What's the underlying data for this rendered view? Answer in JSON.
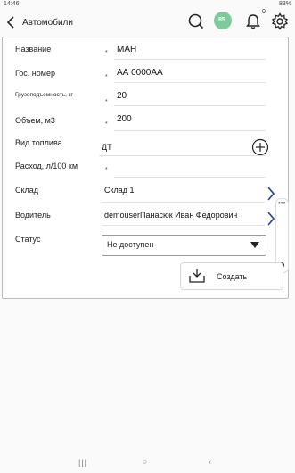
{
  "status_bar": {
    "time": "14:46",
    "battery": "83%"
  },
  "header": {
    "title": "Автомобили",
    "badge_label": "85",
    "notifications_count": "0"
  },
  "form": {
    "name_label": "Название",
    "name_value": "МАН",
    "plate_label": "Гос. номер",
    "plate_value": "АА 0000АА",
    "capacity_label": "Грузоподъемность, кг",
    "capacity_value": "20",
    "volume_label": "Объем, м3",
    "volume_value": "200",
    "fuel_label": "Вид топлива",
    "fuel_value": "ДТ",
    "consumption_label": "Расход, л/100 км",
    "consumption_value": "",
    "warehouse_label": "Склад",
    "warehouse_value": "Склад 1",
    "driver_label": "Водитель",
    "driver_value": "demouserПанасюк Иван Федорович",
    "status_label": "Статус",
    "status_value": "Не доступен",
    "required_mark": "*"
  },
  "actions": {
    "create_label": "Создать"
  },
  "colors": {
    "accent": "#2e3f8f",
    "badge": "#7fc99b",
    "required": "#1f5d2f"
  }
}
